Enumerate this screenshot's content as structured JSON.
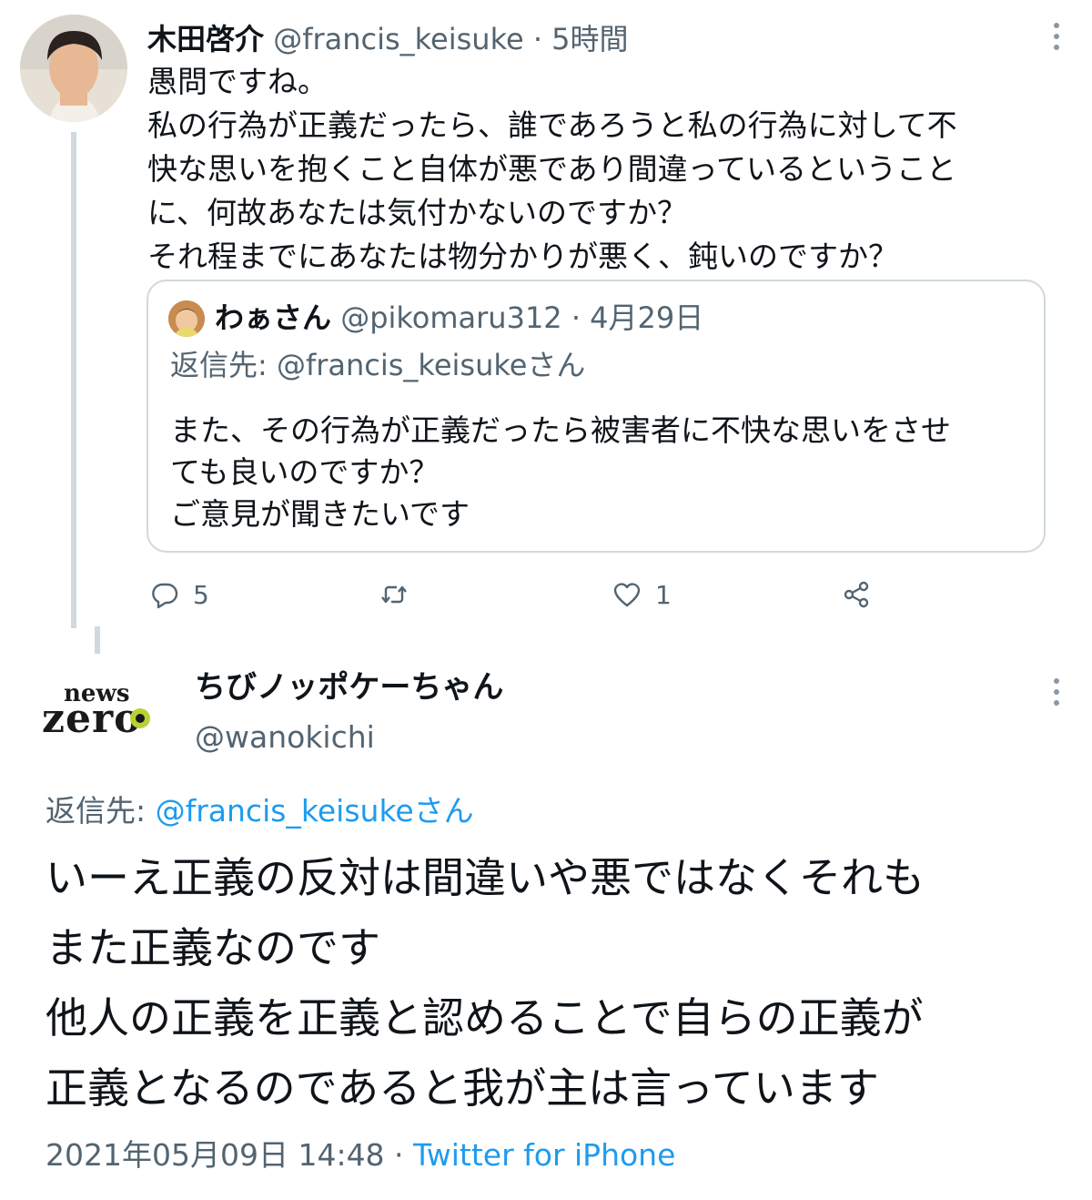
{
  "tweet1": {
    "avatar_icon": "user-photo-avatar",
    "name": "木田啓介",
    "handle": "@francis_keisuke",
    "separator": "·",
    "time": "5時間",
    "body": [
      "愚問ですね。",
      "私の行為が正義だったら、誰であろうと私の行為に対して不",
      "快な思いを抱くこと自体が悪であり間違っているということ",
      "に、何故あなたは気付かないのですか？",
      "それ程までにあなたは物分かりが悪く、鈍いのですか？"
    ],
    "more_icon": "vertical-dots-icon"
  },
  "quote": {
    "avatar_icon": "user-photo-avatar",
    "name": "わぁさん",
    "handle": "@pikomaru312",
    "separator": "·",
    "date": "4月29日",
    "reply_to": "返信先: @francis_keisukeさん",
    "body": [
      "また、その行為が正義だったら被害者に不快な思いをさせ",
      "ても良いのですか？",
      "ご意見が聞きたいです"
    ]
  },
  "actions": {
    "reply_icon": "reply-bubble-icon",
    "reply_count": "5",
    "retweet_icon": "retweet-icon",
    "like_icon": "heart-icon",
    "like_count": "1",
    "share_icon": "share-icon"
  },
  "tweet2": {
    "logo_top": "news",
    "logo_bottom": "zero",
    "name": "ちびノッポケーちゃん",
    "handle": "@wanokichi",
    "more_icon": "vertical-dots-icon",
    "reply_to_label": "返信先: ",
    "reply_to_handle": "@francis_keisukeさん",
    "body": [
      "いーえ正義の反対は間違いや悪ではなくそれも",
      "また正義なのです",
      "他人の正義を正義と認めることで自らの正義が",
      "正義となるのであると我が主は言っています"
    ],
    "timestamp": "2021年05月09日 14:48",
    "separator": " · ",
    "source": "Twitter for iPhone"
  },
  "colors": {
    "text": "#0f1419",
    "secondary": "#536471",
    "link": "#1d9bf0",
    "border": "#cfd9de",
    "logo_green": "#b5d334"
  }
}
